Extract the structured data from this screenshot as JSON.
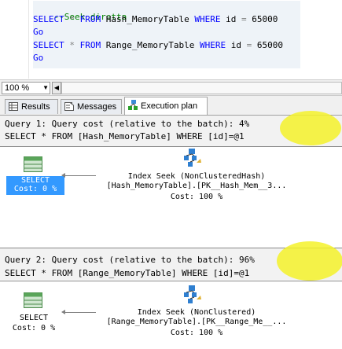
{
  "editor": {
    "lines": [
      {
        "comment": "--Seek diretta"
      },
      {
        "kw1": "SELECT",
        "star": " * ",
        "kw2": "FROM",
        "table": " Hash_MemoryTable ",
        "kw3": "WHERE",
        "cond": " id ",
        "eq": "=",
        "val": " 65000"
      },
      {
        "kw1": "Go"
      },
      {
        "kw1": "SELECT",
        "star": " * ",
        "kw2": "FROM",
        "table": " Range_MemoryTable ",
        "kw3": "WHERE",
        "cond": " id ",
        "eq": "=",
        "val": " 65000"
      },
      {
        "kw1": "Go"
      }
    ]
  },
  "zoom": {
    "value": "100 %"
  },
  "tabs": [
    {
      "label": "Results"
    },
    {
      "label": "Messages"
    },
    {
      "label": "Execution plan"
    }
  ],
  "queries": [
    {
      "header": "Query 1: Query cost (relative to the batch): 4%",
      "sql": "SELECT * FROM [Hash_MemoryTable] WHERE [id]=@1",
      "select_label": "SELECT",
      "select_cost": "Cost: 0 %",
      "op_line1": "Index Seek (NonClusteredHash)",
      "op_line2": "[Hash_MemoryTable].[PK__Hash_Mem__3...",
      "op_cost": "Cost: 100 %"
    },
    {
      "header": "Query 2: Query cost (relative to the batch): 96%",
      "sql": "SELECT * FROM [Range_MemoryTable] WHERE [id]=@1",
      "select_label": "SELECT",
      "select_cost": "Cost: 0 %",
      "op_line1": "Index Seek (NonClustered)",
      "op_line2": "[Range_MemoryTable].[PK__Range_Me__...",
      "op_cost": "Cost: 100 %"
    }
  ],
  "colors": {
    "keyword": "#0000ff",
    "comment": "#008000",
    "highlight": "#f5f22a",
    "selected": "#3399ff"
  }
}
